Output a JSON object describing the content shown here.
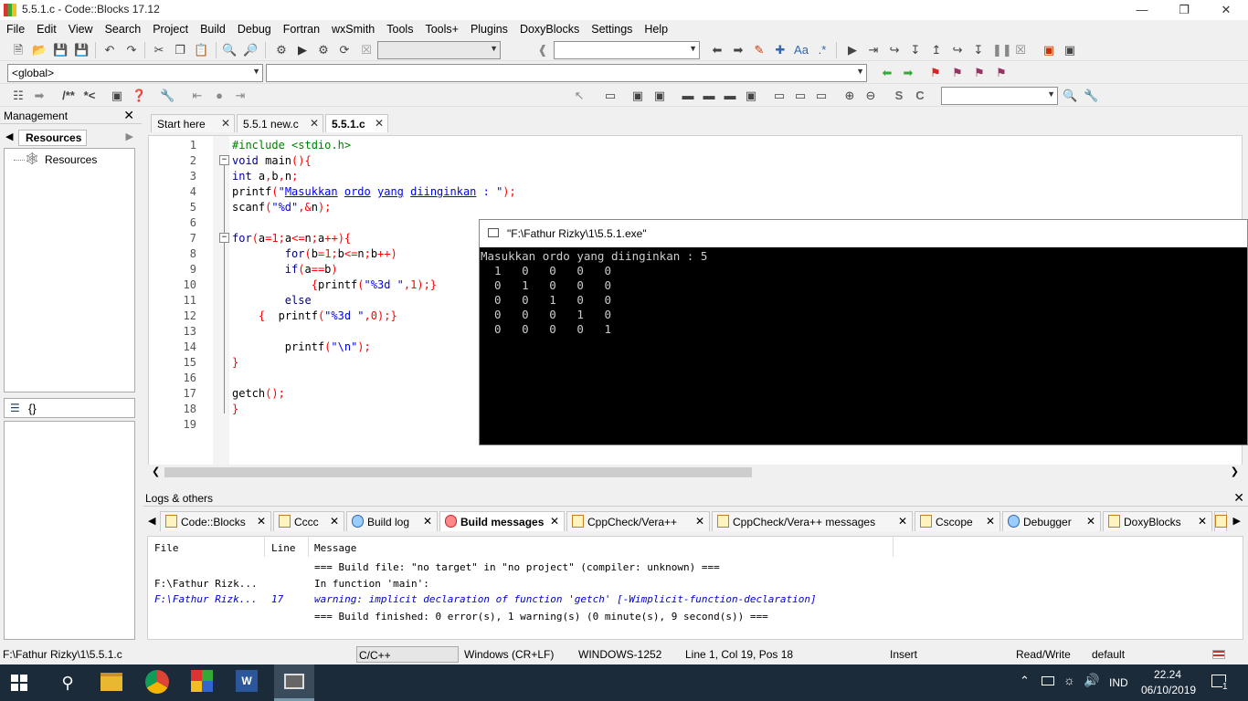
{
  "window": {
    "title": "5.5.1.c - Code::Blocks 17.12"
  },
  "menu": [
    "File",
    "Edit",
    "View",
    "Search",
    "Project",
    "Build",
    "Debug",
    "Fortran",
    "wxSmith",
    "Tools",
    "Tools+",
    "Plugins",
    "DoxyBlocks",
    "Settings",
    "Help"
  ],
  "scope": {
    "value": "<global>"
  },
  "management": {
    "title": "Management",
    "tab": "Resources",
    "tree_item": "Resources",
    "symbols_label": "{}"
  },
  "tabs": [
    {
      "label": "Start here"
    },
    {
      "label": "5.5.1 new.c"
    },
    {
      "label": "5.5.1.c"
    }
  ],
  "code": {
    "line_numbers": [
      "1",
      "2",
      "3",
      "4",
      "5",
      "6",
      "7",
      "8",
      "9",
      "10",
      "11",
      "12",
      "13",
      "14",
      "15",
      "16",
      "17",
      "18",
      "19"
    ]
  },
  "console": {
    "title": "\"F:\\Fathur Rizky\\1\\5.5.1.exe\"",
    "output": "Masukkan ordo yang diinginkan : 5\n  1   0   0   0   0\n  0   1   0   0   0\n  0   0   1   0   0\n  0   0   0   1   0\n  0   0   0   0   1"
  },
  "logs": {
    "title": "Logs & others",
    "tabs": [
      "Code::Blocks",
      "Cccc",
      "Build log",
      "Build messages",
      "CppCheck/Vera++",
      "CppCheck/Vera++ messages",
      "Cscope",
      "Debugger",
      "DoxyBlocks"
    ],
    "headers": {
      "file": "File",
      "line": "Line",
      "message": "Message"
    },
    "rows": [
      {
        "file": "",
        "line": "",
        "message": "=== Build file: \"no target\" in \"no project\" (compiler: unknown) ==="
      },
      {
        "file": "F:\\Fathur Rizk...",
        "line": "",
        "message": "In function 'main':"
      },
      {
        "file": "F:\\Fathur Rizk...",
        "line": "17",
        "message": "warning: implicit declaration of function 'getch' [-Wimplicit-function-declaration]"
      },
      {
        "file": "",
        "line": "",
        "message": "=== Build finished: 0 error(s), 1 warning(s) (0 minute(s), 9 second(s)) ==="
      }
    ]
  },
  "status": {
    "path": "F:\\Fathur Rizky\\1\\5.5.1.c",
    "lang": "C/C++",
    "eol": "Windows (CR+LF)",
    "encoding": "WINDOWS-1252",
    "pos": "Line 1, Col 19, Pos 18",
    "mode": "Insert",
    "rw": "Read/Write",
    "profile": "default"
  },
  "taskbar": {
    "time": "22.24",
    "date": "06/10/2019",
    "lang": "IND",
    "notif": "1"
  }
}
